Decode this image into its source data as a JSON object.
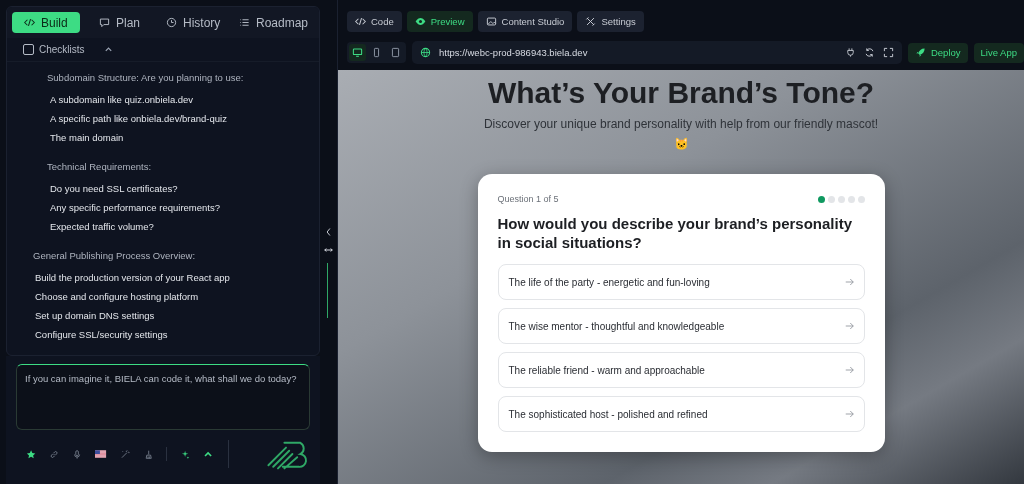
{
  "left_tabs": [
    {
      "label": "Build",
      "selected": true
    },
    {
      "label": "Plan",
      "selected": false
    },
    {
      "label": "History",
      "selected": false
    },
    {
      "label": "Roadmap",
      "selected": false
    }
  ],
  "checklists": {
    "label": "Checklists",
    "checked": false,
    "expanded": true
  },
  "sections": [
    {
      "kind": "sub",
      "title": "Subdomain Structure: Are you planning to use:",
      "items": [
        "A subdomain like quiz.onbiela.dev",
        "A specific path like onbiela.dev/brand-quiz",
        "The main domain"
      ]
    },
    {
      "kind": "sub",
      "title": "Technical Requirements:",
      "items": [
        "Do you need SSL certificates?",
        "Any specific performance requirements?",
        "Expected traffic volume?"
      ]
    },
    {
      "kind": "main",
      "title": "General Publishing Process Overview:",
      "items": [
        "Build the production version of your React app",
        "Choose and configure hosting platform",
        "Set up domain DNS settings",
        "Configure SSL/security settings"
      ]
    }
  ],
  "prompt": {
    "placeholder": "If you can imagine it, BIELA can code it, what shall we do today?"
  },
  "right_tabs": [
    {
      "label": "Code",
      "selected": false
    },
    {
      "label": "Preview",
      "selected": true
    },
    {
      "label": "Content Studio",
      "selected": false
    },
    {
      "label": "Settings",
      "selected": false
    }
  ],
  "devices": [
    {
      "kind": "desktop",
      "selected": true
    },
    {
      "kind": "phone",
      "selected": false
    },
    {
      "kind": "tablet",
      "selected": false
    }
  ],
  "url": "https://webc-prod-986943.biela.dev",
  "actions": [
    {
      "label": "Deploy",
      "kind": "deploy"
    },
    {
      "label": "Live App",
      "kind": "live"
    }
  ],
  "preview": {
    "title": "What’s Your Brand’s Tone?",
    "subtitle": "Discover your unique brand personality with help from our friendly mascot! 🐱",
    "card": {
      "progress": "Question 1 of 5",
      "steps": [
        {
          "selected": true
        },
        {
          "selected": false
        },
        {
          "selected": false
        },
        {
          "selected": false
        },
        {
          "selected": false
        }
      ],
      "question": "How would you describe your brand’s personality in social situations?",
      "options": [
        "The life of the party - energetic and fun-loving",
        "The wise mentor - thoughtful and knowledgeable",
        "The reliable friend - warm and approachable",
        "The sophisticated host - polished and refined"
      ]
    }
  }
}
